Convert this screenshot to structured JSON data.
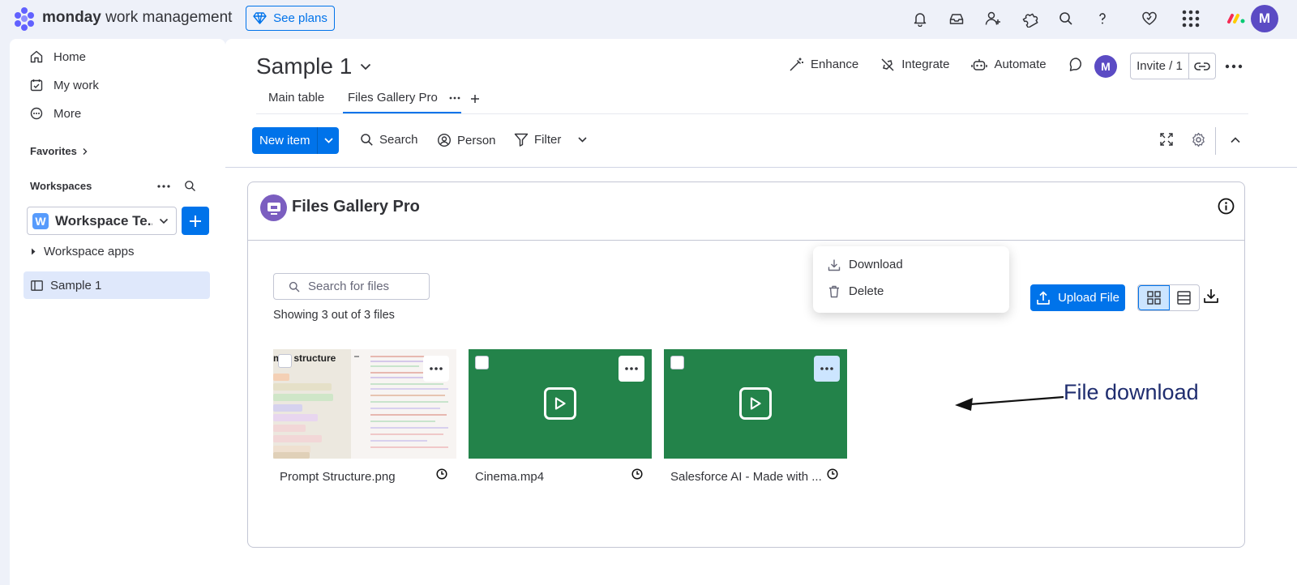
{
  "topbar": {
    "brand_bold": "monday",
    "brand_light": " work management",
    "see_plans": "See plans",
    "user_initial": "M",
    "icons": [
      "bell-icon",
      "inbox-icon",
      "invite-user-icon",
      "apps-icon",
      "search-icon",
      "help-icon",
      "heart-icon",
      "grid-menu-icon"
    ]
  },
  "sidebar": {
    "nav": [
      {
        "label": "Home",
        "icon": "home-icon"
      },
      {
        "label": "My work",
        "icon": "my-work-icon"
      },
      {
        "label": "More",
        "icon": "more-icon"
      }
    ],
    "favorites_label": "Favorites",
    "workspaces_label": "Workspaces",
    "workspace_badge": "W",
    "workspace_name": "Workspace Te...",
    "workspace_apps": "Workspace apps",
    "board_item": "Sample 1"
  },
  "board": {
    "title": "Sample 1",
    "actions": [
      {
        "label": "Enhance",
        "icon": "enhance-icon"
      },
      {
        "label": "Integrate",
        "icon": "integrate-icon"
      },
      {
        "label": "Automate",
        "icon": "automate-icon"
      }
    ],
    "avatar_initial": "M",
    "invite_label": "Invite / 1",
    "tabs": [
      {
        "label": "Main table"
      },
      {
        "label": "Files Gallery Pro",
        "active": true
      }
    ],
    "toolbar": {
      "new_item": "New item",
      "search": "Search",
      "person": "Person",
      "filter": "Filter"
    }
  },
  "app": {
    "title": "Files Gallery Pro",
    "search_placeholder": "Search for files",
    "showing_text": "Showing 3 out of 3 files",
    "upload_label": "Upload File",
    "thumb_title": "mpt structure",
    "files": [
      {
        "name": "Prompt Structure.png",
        "type": "image"
      },
      {
        "name": "Cinema.mp4",
        "type": "video"
      },
      {
        "name": "Salesforce AI - Made with ...",
        "type": "video"
      }
    ],
    "context_menu": {
      "download": "Download",
      "delete": "Delete"
    }
  },
  "annotation": {
    "text": "File download"
  },
  "colors": {
    "primary": "#0073ea",
    "brand_purple": "#6161ff",
    "video_green": "#23834a",
    "avatar": "#5b4bc4"
  }
}
